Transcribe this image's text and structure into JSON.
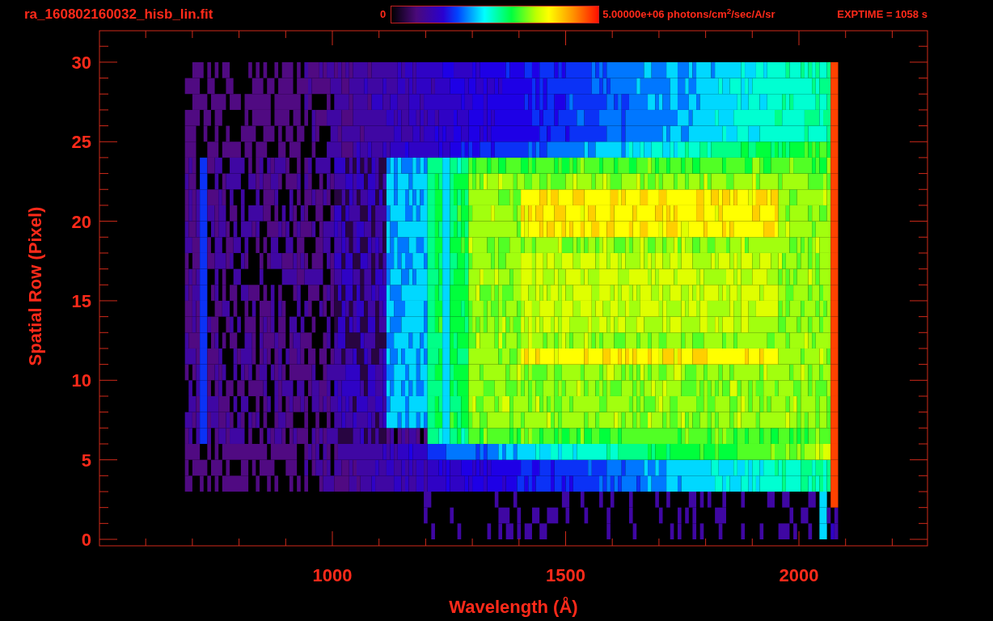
{
  "title": "ra_160802160032_hisb_lin.fit",
  "colorbar": {
    "min_label": "0",
    "max_label": "5.00000e+06 photons/cm$^{2}$/sec/A/sr"
  },
  "exposure": "EXPTIME = 1058 s",
  "plot": {
    "xlabel": "Wavelength (Å)",
    "ylabel": "Spatial Row (Pixel)",
    "xtick_labels": [
      "1000",
      "1500",
      "2000"
    ],
    "ytick_labels": [
      "30",
      "25",
      "20",
      "15",
      "10",
      "5",
      "0"
    ]
  }
}
